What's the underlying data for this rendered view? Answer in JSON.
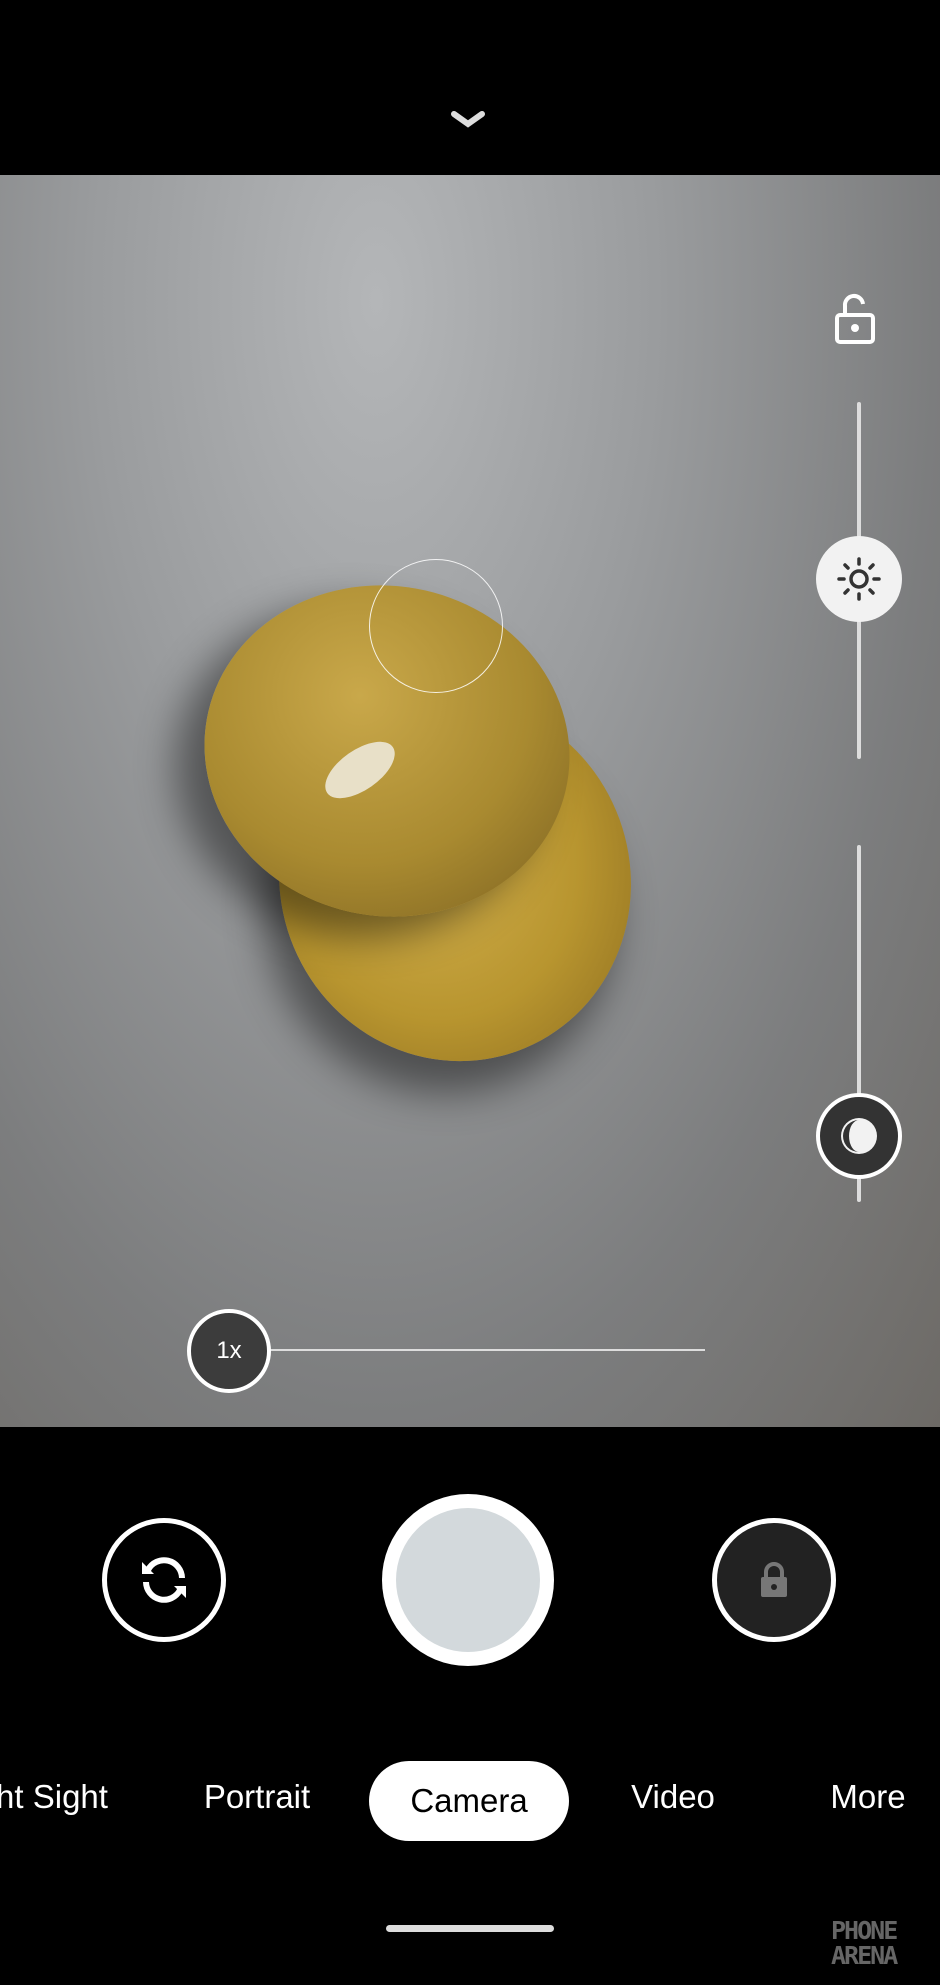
{
  "top": {
    "collapse_icon": "chevron-down-icon"
  },
  "viewfinder": {
    "lock_icon": "unlock-icon",
    "exposure_slider": {
      "icon": "sun-icon",
      "value": 0.5
    },
    "contrast_slider": {
      "icon": "contrast-icon",
      "value": 0.82
    },
    "zoom": {
      "label": "1x",
      "value": 0
    }
  },
  "controls": {
    "switch_camera_icon": "camera-switch-icon",
    "shutter_color": "#d3d9dc",
    "lock_icon": "lock-icon"
  },
  "modes": {
    "items": [
      "Night Sight",
      "Portrait",
      "Camera",
      "Video",
      "More"
    ],
    "visible_first": "ht Sight",
    "selected": "Camera"
  },
  "watermark": "PHONE ARENA"
}
